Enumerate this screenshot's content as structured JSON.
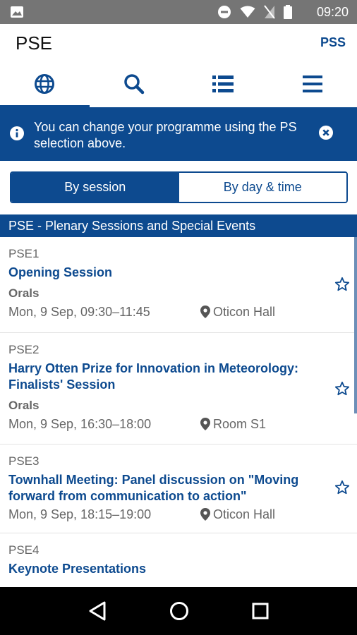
{
  "statusbar": {
    "time": "09:20",
    "icons": [
      "image-icon",
      "do-not-disturb-icon",
      "wifi-icon",
      "no-signal-icon",
      "battery-icon"
    ]
  },
  "header": {
    "title": "PSE",
    "action_label": "PSS"
  },
  "tabs": [
    {
      "icon": "globe-icon",
      "active": true
    },
    {
      "icon": "search-icon",
      "active": false
    },
    {
      "icon": "list-icon",
      "active": false
    },
    {
      "icon": "menu-icon",
      "active": false
    }
  ],
  "banner": {
    "text": "You can change your programme using the PS selection above."
  },
  "segment": {
    "by_session": "By session",
    "by_day_time": "By day & time"
  },
  "section_title": "PSE - Plenary Sessions and Special Events",
  "sessions": [
    {
      "code": "PSE1",
      "title": "Opening Session",
      "type": "Orals",
      "time": "Mon, 9 Sep, 09:30–11:45",
      "room": "Oticon Hall"
    },
    {
      "code": "PSE2",
      "title": "Harry Otten Prize for Innovation in Meteorology: Finalists' Session",
      "type": "Orals",
      "time": "Mon, 9 Sep, 16:30–18:00",
      "room": "Room S1"
    },
    {
      "code": "PSE3",
      "title": "Townhall Meeting: Panel discussion on \"Moving forward from communication to action\"",
      "type": "",
      "time": "Mon, 9 Sep, 18:15–19:00",
      "room": "Oticon Hall"
    },
    {
      "code": "PSE4",
      "title": "Keynote Presentations",
      "type": "",
      "time": "",
      "room": ""
    }
  ],
  "colors": {
    "primary": "#0d4a8f",
    "status_bar": "#757575",
    "muted_text": "#666666"
  }
}
